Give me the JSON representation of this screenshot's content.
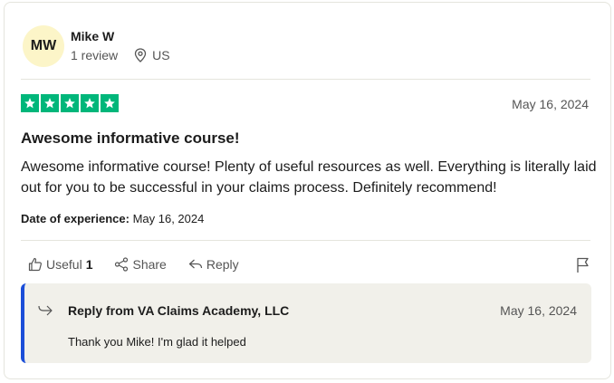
{
  "reviewer": {
    "initials": "MW",
    "name": "Mike W",
    "review_count": "1 review",
    "country": "US"
  },
  "review": {
    "rating": 5,
    "date": "May 16, 2024",
    "title": "Awesome informative course!",
    "body": "Awesome informative course! Plenty of useful resources as well. Everything is literally laid out for you to be successful in your claims process. Definitely recommend!",
    "experience_label": "Date of experience:",
    "experience_date": "May 16, 2024"
  },
  "actions": {
    "useful_label": "Useful",
    "useful_count": "1",
    "share_label": "Share",
    "reply_label": "Reply"
  },
  "company_reply": {
    "from": "Reply from VA Claims Academy, LLC",
    "date": "May 16, 2024",
    "text": "Thank you Mike! I'm glad it helped"
  },
  "colors": {
    "star_green": "#00b67a",
    "reply_accent": "#1b4ed8",
    "avatar_bg": "#fcf5c8"
  }
}
